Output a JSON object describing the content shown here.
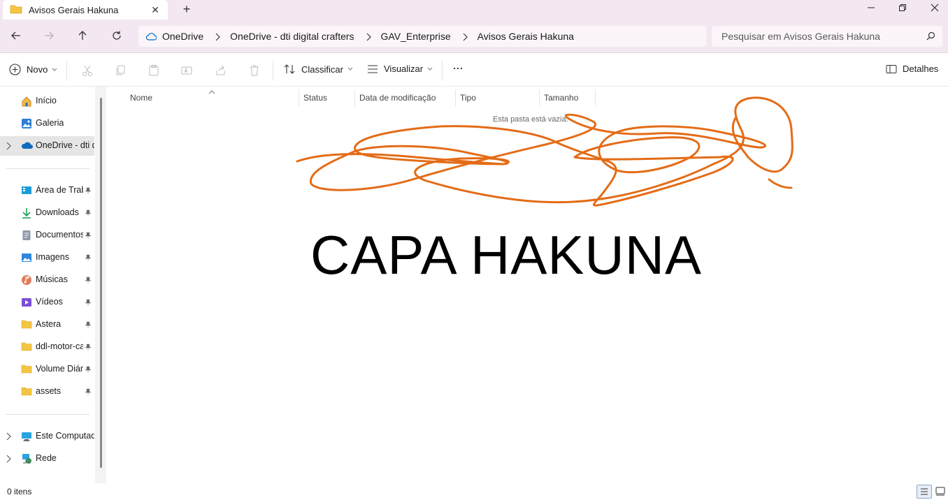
{
  "window": {
    "tab_title": "Avisos Gerais Hakuna",
    "new_tab_symbol": "+",
    "close_tab_symbol": "✕"
  },
  "address": {
    "crumbs": [
      "OneDrive",
      "OneDrive - dti digital crafters",
      "GAV_Enterprise",
      "Avisos Gerais Hakuna"
    ]
  },
  "search": {
    "placeholder": "Pesquisar em Avisos Gerais Hakuna"
  },
  "toolbar": {
    "new_label": "Novo",
    "sort_label": "Classificar",
    "view_label": "Visualizar",
    "more_label": "···",
    "details_label": "Detalhes"
  },
  "sidebar": {
    "items": [
      {
        "label": "Início",
        "icon": "home-icon"
      },
      {
        "label": "Galeria",
        "icon": "gallery-icon"
      },
      {
        "label": "OneDrive - dti d",
        "icon": "onedrive-icon"
      },
      {
        "label": "Área de Traba",
        "icon": "desktop-icon"
      },
      {
        "label": "Downloads",
        "icon": "download-icon"
      },
      {
        "label": "Documentos",
        "icon": "documents-icon"
      },
      {
        "label": "Imagens",
        "icon": "pictures-icon"
      },
      {
        "label": "Músicas",
        "icon": "music-icon"
      },
      {
        "label": "Vídeos",
        "icon": "videos-icon"
      },
      {
        "label": "Astera",
        "icon": "folder-icon"
      },
      {
        "label": "ddl-motor-ca",
        "icon": "folder-icon"
      },
      {
        "label": "Volume Diári",
        "icon": "folder-icon"
      },
      {
        "label": "assets",
        "icon": "folder-icon"
      },
      {
        "label": "Este Computador",
        "icon": "computer-icon"
      },
      {
        "label": "Rede",
        "icon": "network-icon"
      }
    ]
  },
  "columns": [
    "Nome",
    "Status",
    "Data de modificação",
    "Tipo",
    "Tamanho"
  ],
  "content": {
    "empty_message": "Esta pasta está vazia.",
    "overlay_text": "CAPA HAKUNA"
  },
  "status": {
    "item_count": "0 itens"
  },
  "colors": {
    "titlebar_bg": "#f3e7f1",
    "scribble": "#e36c17",
    "folder": "#f4c542",
    "accent": "#0067c0"
  }
}
